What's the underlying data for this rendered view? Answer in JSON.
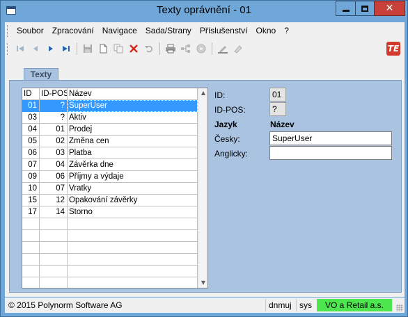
{
  "window": {
    "title": "Texty oprávnění - 01",
    "close_glyph": "✕"
  },
  "menu": [
    "Soubor",
    "Zpracování",
    "Navigace",
    "Sada/Strany",
    "Příslušenství",
    "Okno",
    "?"
  ],
  "toolbar": {
    "icons": [
      "first-record-icon",
      "previous-record-icon",
      "next-record-icon",
      "last-record-icon",
      "save-icon",
      "new-icon",
      "copy-icon",
      "delete-icon",
      "undo-icon",
      "print-icon",
      "tree-icon",
      "disc-icon",
      "edit-icon",
      "eraser-icon"
    ],
    "logo_text": "TE"
  },
  "tabs": [
    {
      "label": "Texty"
    }
  ],
  "grid": {
    "columns": [
      "ID",
      "ID-POS",
      "Název"
    ],
    "selected_row": 0,
    "rows": [
      {
        "id": "01",
        "pos": "?",
        "name": "SuperUser"
      },
      {
        "id": "03",
        "pos": "?",
        "name": "Aktiv"
      },
      {
        "id": "04",
        "pos": "01",
        "name": "Prodej"
      },
      {
        "id": "05",
        "pos": "02",
        "name": "Změna cen"
      },
      {
        "id": "06",
        "pos": "03",
        "name": "Platba"
      },
      {
        "id": "07",
        "pos": "04",
        "name": "Závěrka dne"
      },
      {
        "id": "09",
        "pos": "06",
        "name": "Příjmy a výdaje"
      },
      {
        "id": "10",
        "pos": "07",
        "name": "Vratky"
      },
      {
        "id": "15",
        "pos": "12",
        "name": "Opakování závěrky"
      },
      {
        "id": "17",
        "pos": "14",
        "name": "Storno"
      }
    ],
    "scroll_up_glyph": "▲",
    "scroll_down_glyph": "▼"
  },
  "detail": {
    "id_label": "ID:",
    "id_value": "01",
    "idpos_label": "ID-POS:",
    "idpos_value": "?",
    "language_header": "Jazyk",
    "name_header": "Název",
    "czech_label": "Česky:",
    "czech_value": "SuperUser",
    "english_label": "Anglicky:",
    "english_value": ""
  },
  "status": {
    "copyright": "© 2015 Polynorm Software AG",
    "user": "dnmuj",
    "role": "sys",
    "company": "VO a Retail a.s."
  },
  "colors": {
    "window_frame": "#6fa7d8",
    "panel": "#a9c3e1",
    "selection": "#3399ff",
    "status_green": "#4ee64e",
    "close_button": "#c7403a"
  }
}
